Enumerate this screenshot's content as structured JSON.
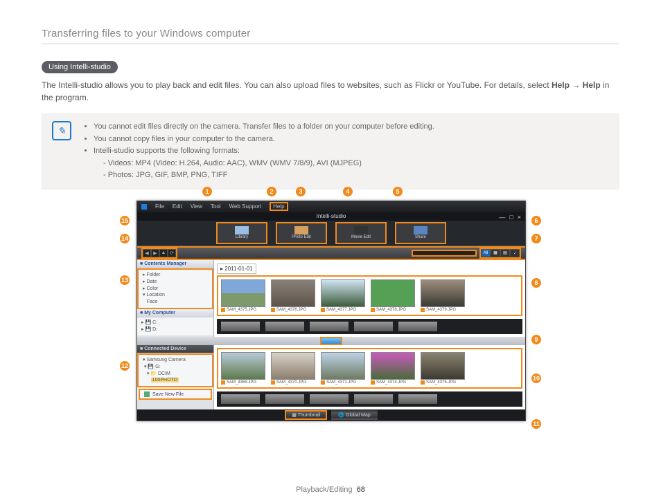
{
  "page": {
    "header": "Transferring files to your Windows computer",
    "section_pill": "Using Intelli-studio",
    "intro_1": "The Intelli-studio allows you to play back and edit files. You can also upload files to websites, such as Flickr or YouTube. For details, select ",
    "intro_help1": "Help",
    "intro_arrow": " → ",
    "intro_help2": "Help",
    "intro_2": " in the program.",
    "footer_section": "Playback/Editing",
    "footer_page": "68"
  },
  "notes": {
    "bul1": "You cannot edit files directly on the camera. Transfer files to a folder on your computer before editing.",
    "bul2": "You cannot copy files in your computer to the camera.",
    "bul3": "Intelli-studio supports the following formats:",
    "sub1": "Videos: MP4 (Video: H.264, Audio: AAC), WMV (WMV 7/8/9), AVI (MJPEG)",
    "sub2": "Photos: JPG, GIF, BMP, PNG, TIFF"
  },
  "app": {
    "menus": {
      "file": "File",
      "edit": "Edit",
      "view": "View",
      "tool": "Tool",
      "web": "Web Support",
      "help": "Help"
    },
    "title": "Intelli-studio",
    "tabs": {
      "library": "Library",
      "photo": "Photo Edit",
      "movie": "Movie Edit",
      "share": "Share"
    },
    "viewbtn_all": "All",
    "sidebar": {
      "contents_h": "Contents Manager",
      "tree_folder": "Folder",
      "tree_date": "Date",
      "tree_color": "Color",
      "tree_location": "Location",
      "tree_face": "Face",
      "mycomp_h": "My Computer",
      "drive_c": "C:",
      "drive_d": "D:",
      "conn_h": "Connected Device",
      "cam": "Samsung Camera",
      "drive_g": "G:",
      "dcim": "DCIM",
      "ph": "100PHOTO",
      "save": "Save New File"
    },
    "gallery": {
      "date": "2011-01-01",
      "row1": [
        "SAM_4375.JPG",
        "SAM_4376.JPG",
        "SAM_4377.JPG",
        "SAM_4378.JPG",
        "SAM_4379.JPG"
      ],
      "row2": [
        "SAM_4369.JPG",
        "SAM_4370.JPG",
        "SAM_4371.JPG",
        "SAM_4374.JPG",
        "SAM_4375.JPG"
      ]
    },
    "bottom": {
      "thumb": "Thumbnail",
      "map": "Global Map"
    }
  },
  "callouts": {
    "c1": "1",
    "c2": "2",
    "c3": "3",
    "c4": "4",
    "c5": "5",
    "c6": "6",
    "c7": "7",
    "c8": "8",
    "c9": "9",
    "c10": "10",
    "c11": "11",
    "c12": "12",
    "c13": "13",
    "c14": "14",
    "c15": "15"
  }
}
